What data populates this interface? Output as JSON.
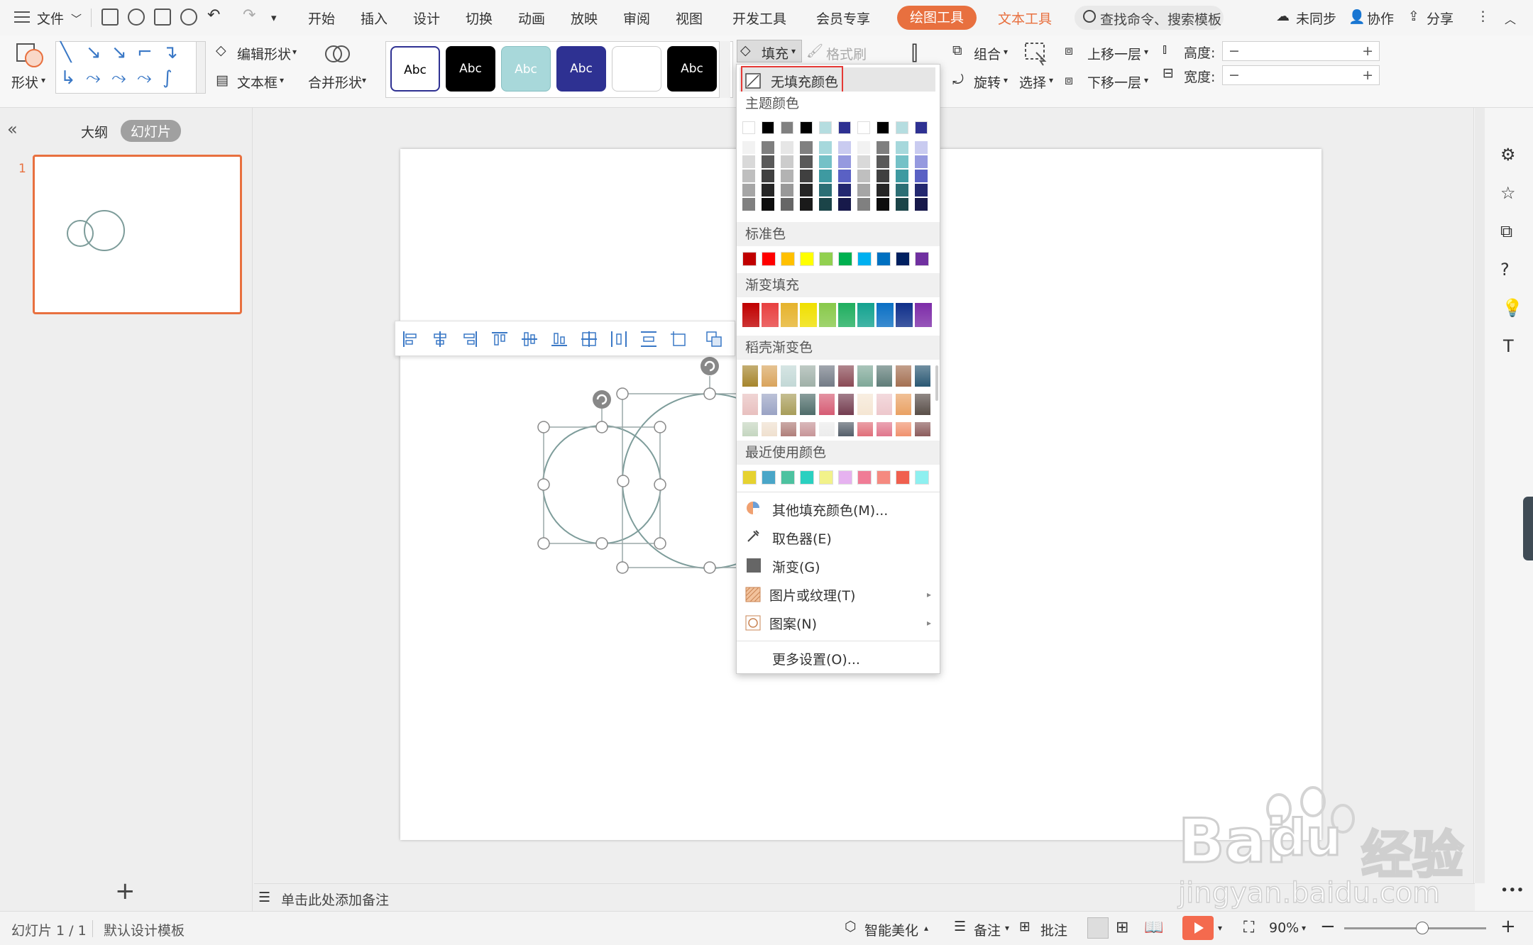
{
  "menubar": {
    "file": "文件",
    "tabs": [
      "开始",
      "插入",
      "设计",
      "切换",
      "动画",
      "放映",
      "审阅",
      "视图",
      "开发工具",
      "会员专享"
    ],
    "drawing_tools": "绘图工具",
    "text_tools": "文本工具",
    "search_placeholder": "查找命令、搜索模板",
    "unsynced": "未同步",
    "collab": "协作",
    "share": "分享"
  },
  "ribbon": {
    "shape": "形状",
    "edit_shape": "编辑形状",
    "textbox": "文本框",
    "merge_shape": "合并形状",
    "style_samples": [
      "Abc",
      "Abc",
      "Abc",
      "Abc",
      "",
      "Abc"
    ],
    "fill": "填充",
    "format_painter": "格式刷",
    "group": "组合",
    "rotate": "旋转",
    "select": "选择",
    "bring_forward": "上移一层",
    "send_backward": "下移一层",
    "height_label": "高度:",
    "width_label": "宽度:",
    "minus": "−",
    "plus": "+"
  },
  "leftpanel": {
    "outline_tab": "大纲",
    "slides_tab": "幻灯片",
    "slide_number": "1",
    "collapse": "«",
    "add": "+"
  },
  "notes": {
    "placeholder": "单击此处添加备注"
  },
  "dropdown": {
    "no_fill": "无填充颜色",
    "theme_colors": "主题颜色",
    "standard_colors": "标准色",
    "gradient_fill": "渐变填充",
    "docer_gradient": "稻壳渐变色",
    "recent_colors": "最近使用颜色",
    "more_fill": "其他填充颜色(M)...",
    "eyedropper": "取色器(E)",
    "gradient": "渐变(G)",
    "picture_texture": "图片或纹理(T)",
    "pattern": "图案(N)",
    "more_settings": "更多设置(O)...",
    "theme_top": [
      "#ffffff",
      "#000000",
      "#808080",
      "#000000",
      "#b5dde0",
      "#2e3192",
      "#ffffff",
      "#000000",
      "#b5dde0",
      "#2e3192"
    ],
    "theme_shades": [
      [
        "#f2f2f2",
        "#d9d9d9",
        "#bfbfbf",
        "#a6a6a6",
        "#808080"
      ],
      [
        "#7f7f7f",
        "#595959",
        "#404040",
        "#262626",
        "#0d0d0d"
      ],
      [
        "#e6e6e6",
        "#cccccc",
        "#b3b3b3",
        "#999999",
        "#666666"
      ],
      [
        "#808080",
        "#595959",
        "#404040",
        "#262626",
        "#1a1a1a"
      ],
      [
        "#a6d8dc",
        "#74c1c7",
        "#3e9aa1",
        "#2c6f75",
        "#1b4448"
      ],
      [
        "#c9cbf0",
        "#9599df",
        "#5a61c4",
        "#232870",
        "#17194a"
      ],
      [
        "#f2f2f2",
        "#d9d9d9",
        "#bfbfbf",
        "#a6a6a6",
        "#808080"
      ],
      [
        "#7f7f7f",
        "#595959",
        "#404040",
        "#262626",
        "#0d0d0d"
      ],
      [
        "#a6d8dc",
        "#74c1c7",
        "#3e9aa1",
        "#2c6f75",
        "#1b4448"
      ],
      [
        "#c9cbf0",
        "#9599df",
        "#5a61c4",
        "#232870",
        "#17194a"
      ]
    ],
    "standard": [
      "#c00000",
      "#ff0000",
      "#ffc000",
      "#ffff00",
      "#92d050",
      "#00b050",
      "#00b0f0",
      "#0070c0",
      "#002060",
      "#7030a0"
    ],
    "gradient_swatches": [
      "#c00000",
      "#e84040",
      "#e6b32c",
      "#f0e000",
      "#88c94a",
      "#1fae5f",
      "#13a28f",
      "#0a6fc4",
      "#0f2f8a",
      "#7d2ca8"
    ],
    "docer_rows": [
      [
        "#a6852c",
        "#d9a45c",
        "#c2d8d6",
        "#9fb0a8",
        "#737b86",
        "#8a4a55",
        "#7fa898",
        "#5f7c78",
        "#a47052",
        "#2a5873"
      ],
      [
        "#e8c0bf",
        "#9aa3c4",
        "#a89d5a",
        "#4f6d6a",
        "#d65c74",
        "#743d50",
        "#f5e6d3",
        "#edc7cc",
        "#e9a163",
        "#594e48"
      ],
      [
        "#c5d6c0",
        "#efe0cf",
        "#b07f7a",
        "#c79598",
        "#ececec",
        "#555f6a",
        "#e06f7a",
        "#e0768c",
        "#f0926e",
        "#8c5c5c"
      ]
    ],
    "recent": [
      "#e6d230",
      "#4aa6c8",
      "#4dc2a0",
      "#2ad0c0",
      "#f2f28a",
      "#e6b2f0",
      "#f07c96",
      "#f58a80",
      "#f0604f",
      "#8ef0f0"
    ]
  },
  "statusbar": {
    "slide_count": "幻灯片 1 / 1",
    "template": "默认设计模板",
    "beautify": "智能美化",
    "notes": "备注",
    "comments": "批注",
    "zoom": "90%",
    "zoom_value": 0.55
  },
  "watermark": {
    "brand": "Bai",
    "brand2": "du",
    "suffix": "经验",
    "url": "jingyan.baidu.com"
  },
  "colors": {
    "accent": "#e8703f",
    "no_fill_highlight": "#e53935",
    "circle_stroke": "#7d9c9a",
    "play": "#f46a4e"
  }
}
